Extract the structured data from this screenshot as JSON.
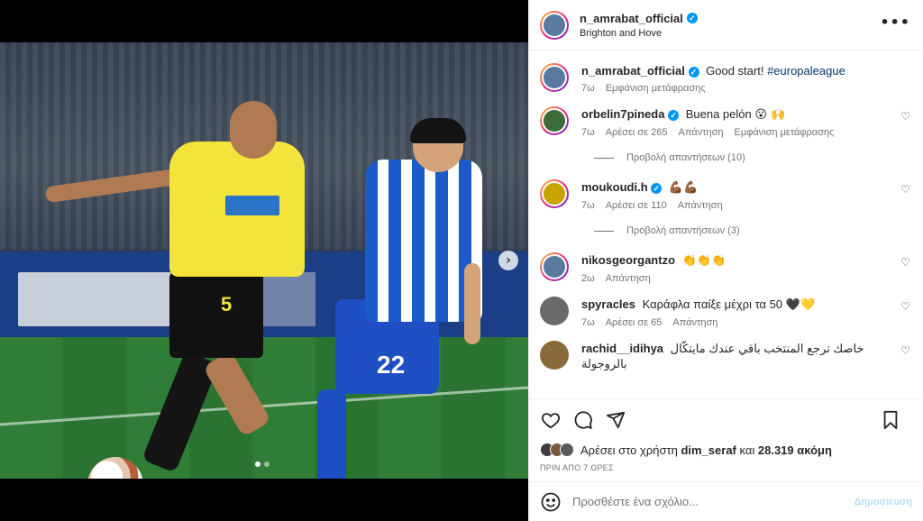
{
  "post": {
    "author": "n_amrabat_official",
    "location": "Brighton and Hove",
    "caption_user": "n_amrabat_official",
    "caption_text": "Good start!",
    "caption_hashtag": "#europaleague",
    "caption_time": "7ω",
    "caption_translate": "Εμφάνιση μετάφρασης"
  },
  "image": {
    "player1_number": "5",
    "player2_number": "22",
    "carousel_index": 1,
    "carousel_count": 2
  },
  "comments": [
    {
      "user": "orbelin7pineda",
      "verified": true,
      "text": "Buena pelón",
      "emoji": "😮 🙌",
      "time": "7ω",
      "likes": "Αρέσει σε 265",
      "reply": "Απάντηση",
      "translate": "Εμφάνιση μετάφρασης",
      "replies": "Προβολή απαντήσεων (10)"
    },
    {
      "user": "moukoudi.h",
      "verified": true,
      "text": "",
      "emoji": "💪🏾💪🏾",
      "time": "7ω",
      "likes": "Αρέσει σε 110",
      "reply": "Απάντηση",
      "replies": "Προβολή απαντήσεων (3)"
    },
    {
      "user": "nikosgeorgantzo",
      "verified": false,
      "text": "",
      "emoji": "👏👏👏",
      "time": "2ω",
      "reply": "Απάντηση"
    },
    {
      "user": "spyracles",
      "verified": false,
      "text": "Καράφλα παίξε μέχρι τα 50",
      "emoji": "🖤💛",
      "time": "7ω",
      "likes": "Αρέσει σε 65",
      "reply": "Απάντηση"
    },
    {
      "user": "rachid__idihya",
      "verified": false,
      "text": "خاصك ترجع المنتخب باقي عندك مايتكّال بالروجولة",
      "emoji": ""
    }
  ],
  "likes": {
    "prefix": "Αρέσει στο χρήστη",
    "user": "dim_seraf",
    "joiner": "και",
    "count": "28.319 ακόμη"
  },
  "time_ago": "ΠΡΙΝ ΑΠΟ 7 ΩΡΕΣ",
  "comment_box": {
    "placeholder": "Προσθέστε ένα σχόλιο...",
    "post_label": "Δημοσίευση"
  },
  "colors": {
    "verified": "#0095f6",
    "hashtag": "#00376b",
    "post_button_disabled": "#b2dffc"
  }
}
